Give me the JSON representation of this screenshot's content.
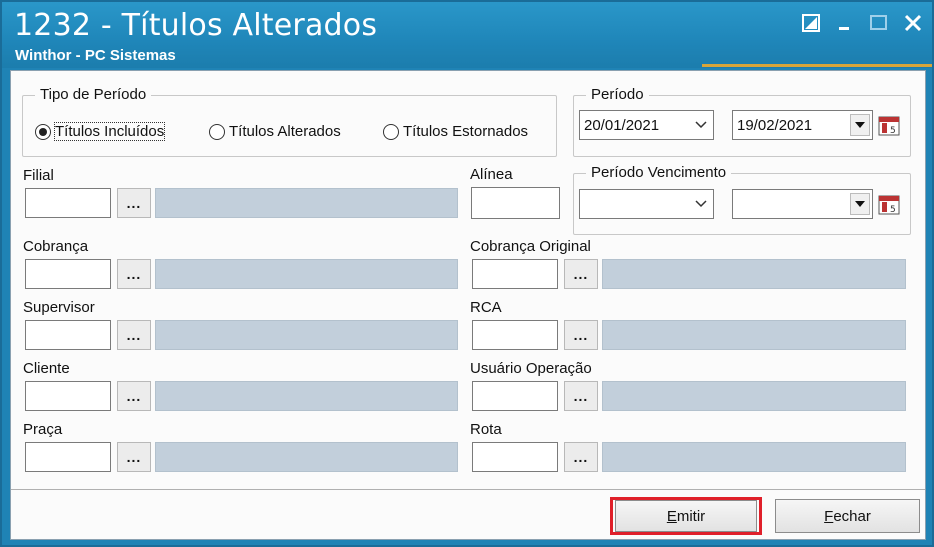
{
  "window": {
    "title": "1232 - Títulos Alterados",
    "subtitle": "Winthor - PC Sistemas"
  },
  "tipo_periodo": {
    "legend": "Tipo de Período",
    "options": [
      {
        "label": "Títulos Incluídos",
        "selected": true
      },
      {
        "label": "Títulos Alterados",
        "selected": false
      },
      {
        "label": "Títulos Estornados",
        "selected": false
      }
    ]
  },
  "periodo": {
    "legend": "Período",
    "start": "20/01/2021",
    "end": "19/02/2021"
  },
  "periodo_vencimento": {
    "legend": "Período Vencimento",
    "start": "",
    "end": ""
  },
  "fields": {
    "filial": "Filial",
    "alinea": "Alínea",
    "cobranca": "Cobrança",
    "cobranca_original": "Cobrança Original",
    "supervisor": "Supervisor",
    "rca": "RCA",
    "cliente": "Cliente",
    "usuario_operacao": "Usuário Operação",
    "praca": "Praça",
    "rota": "Rota"
  },
  "lookup_button": "...",
  "buttons": {
    "emitir_first": "E",
    "emitir_rest": "mitir",
    "fechar_first": "F",
    "fechar_rest": "echar"
  },
  "colors": {
    "titlebar": "#1f86b9",
    "highlight": "#e0202a",
    "description_field": "#c2cfdb"
  }
}
